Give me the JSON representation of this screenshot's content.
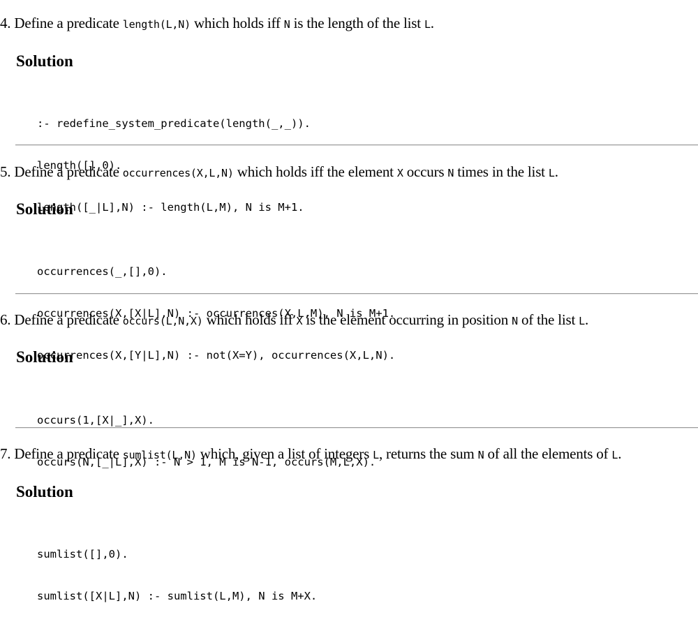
{
  "exercises": [
    {
      "q_prefix": "4. Define a predicate ",
      "q_code1": "length(L,N)",
      "q_mid1": " which holds iff ",
      "q_code2": "N",
      "q_mid2": " is the length of the list ",
      "q_code3": "L",
      "q_end": ".",
      "solution_label": "Solution",
      "code": [
        ":- redefine_system_predicate(length(_,_)).",
        "length([],0).",
        "length([_|L],N) :- length(L,M), N is M+1."
      ]
    },
    {
      "q_prefix": "5. Define a predicate ",
      "q_code1": "occurrences(X,L,N)",
      "q_mid1": " which holds iff the element ",
      "q_code2": "X",
      "q_mid2": " occurs ",
      "q_code3": "N",
      "q_mid3": " times in the list ",
      "q_code4": "L",
      "q_end": ".",
      "solution_label": "Solution",
      "code": [
        "occurrences(_,[],0).",
        "occurrences(X,[X|L],N) :- occurrences(X,L,M), N is M+1.",
        "occurrences(X,[Y|L],N) :- not(X=Y), occurrences(X,L,N)."
      ]
    },
    {
      "q_prefix": "6. Define a predicate ",
      "q_code1": "occurs(L,N,X)",
      "q_mid1": " which holds iff ",
      "q_code2": "X",
      "q_mid2": " is the element occurring in position ",
      "q_code3": "N",
      "q_mid3": " of the list ",
      "q_code4": "L",
      "q_end": ".",
      "solution_label": "Solution",
      "code": [
        "occurs(1,[X|_],X).",
        "occurs(N,[_|L],X) :- N > 1, M is N-1, occurs(M,L,X)."
      ]
    },
    {
      "q_prefix": "7. Define a predicate ",
      "q_code1": "sumlist(L,N)",
      "q_mid1": " which, given a list of integers ",
      "q_code2": "L",
      "q_mid2": ", returns the sum ",
      "q_code3": "N",
      "q_mid3": " of all the elements of ",
      "q_code4": "L",
      "q_end": ".",
      "solution_label": "Solution",
      "code": [
        "sumlist([],0).",
        "sumlist([X|L],N) :- sumlist(L,M), N is M+X."
      ]
    }
  ]
}
